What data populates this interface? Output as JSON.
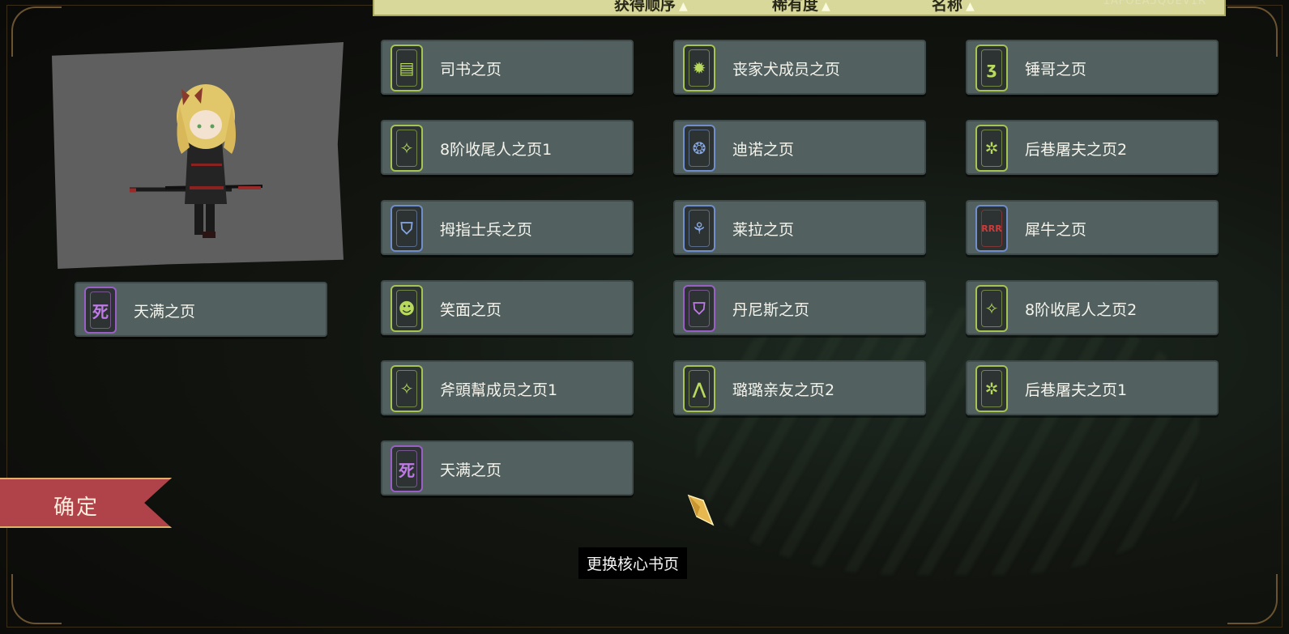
{
  "sort_bar": {
    "items": [
      {
        "label": "获得顺序",
        "arrow": "▲"
      },
      {
        "label": "稀有度",
        "arrow": "▲"
      },
      {
        "label": "名称",
        "arrow": "▲"
      }
    ],
    "watermark": "1AFOEA5QUEV1R"
  },
  "equipped": {
    "label": "天满之页",
    "icon": "purple-page-icon",
    "icon_glyph": "死",
    "tier_color": "#9a5fc7"
  },
  "pages": [
    {
      "label": "司书之页",
      "tier": "green",
      "glyph": "▤"
    },
    {
      "label": "丧家犬成员之页",
      "tier": "green",
      "glyph": "✹"
    },
    {
      "label": "锤哥之页",
      "tier": "green",
      "glyph": "ʒ"
    },
    {
      "label": "8阶收尾人之页1",
      "tier": "green",
      "glyph": "✧"
    },
    {
      "label": "迪诺之页",
      "tier": "blue",
      "glyph": "❂"
    },
    {
      "label": "后巷屠夫之页2",
      "tier": "green",
      "glyph": "✲"
    },
    {
      "label": "拇指士兵之页",
      "tier": "blue",
      "glyph": "⛉"
    },
    {
      "label": "莱拉之页",
      "tier": "blue",
      "glyph": "⚘"
    },
    {
      "label": "犀牛之页",
      "tier": "blue",
      "glyph": "RRR"
    },
    {
      "label": "笑面之页",
      "tier": "green",
      "glyph": "☻"
    },
    {
      "label": "丹尼斯之页",
      "tier": "purple",
      "glyph": "⛉"
    },
    {
      "label": "8阶收尾人之页2",
      "tier": "green",
      "glyph": "✧"
    },
    {
      "label": "斧頭幫成员之页1",
      "tier": "green",
      "glyph": "✧"
    },
    {
      "label": "璐璐亲友之页2",
      "tier": "green",
      "glyph": "⋀"
    },
    {
      "label": "后巷屠夫之页1",
      "tier": "green",
      "glyph": "✲"
    },
    {
      "label": "天满之页",
      "tier": "purple",
      "glyph": "死"
    }
  ],
  "buttons": {
    "confirm": "确定",
    "swap_core_page": "更换核心书页"
  },
  "colors": {
    "green": "#a5c451",
    "blue": "#6f8ecb",
    "purple": "#9a5fc7",
    "confirm_red": "#b0434a"
  }
}
